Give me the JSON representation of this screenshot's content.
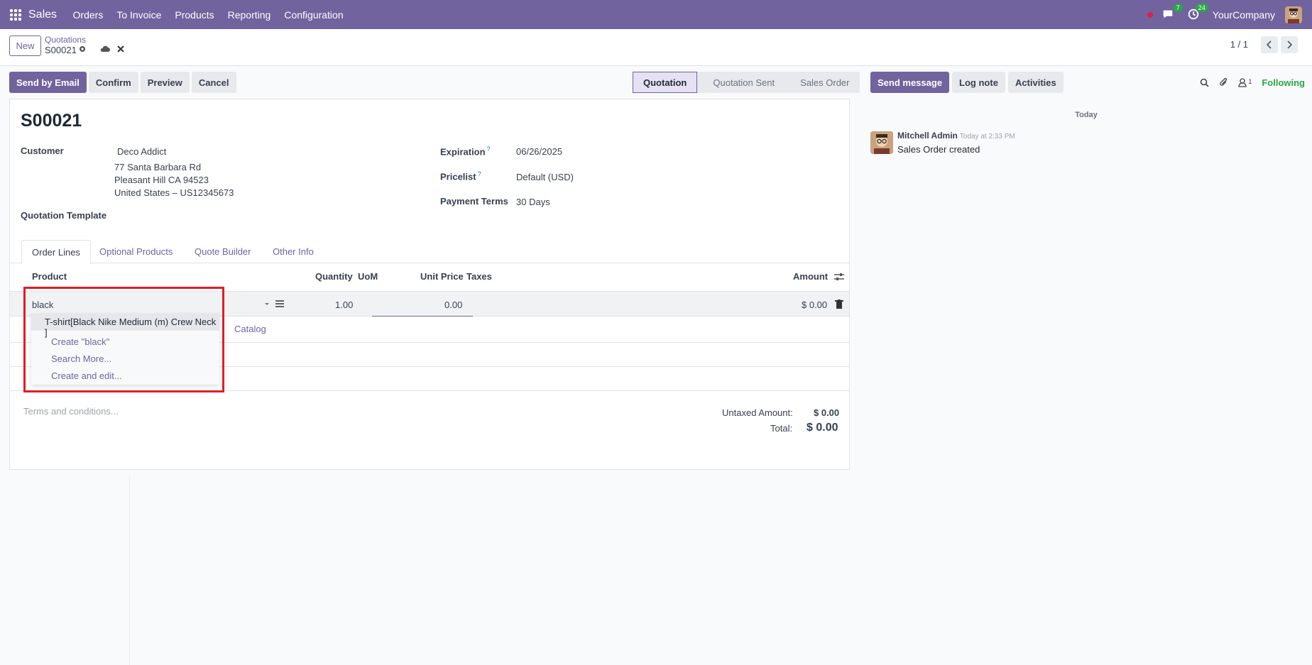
{
  "navbar": {
    "app_name": "Sales",
    "menu": [
      "Orders",
      "To Invoice",
      "Products",
      "Reporting",
      "Configuration"
    ],
    "messages_count": "7",
    "activities_count": "24",
    "company": "YourCompany"
  },
  "control": {
    "new_label": "New",
    "breadcrumb_parent": "Quotations",
    "breadcrumb_current": "S00021",
    "pager": "1 / 1"
  },
  "actions": {
    "send_email": "Send by Email",
    "confirm": "Confirm",
    "preview": "Preview",
    "cancel": "Cancel"
  },
  "status": {
    "stages": [
      "Quotation",
      "Quotation Sent",
      "Sales Order"
    ],
    "active": "Quotation"
  },
  "form": {
    "title": "S00021",
    "customer_label": "Customer",
    "customer_name": "Deco Addict",
    "address_1": "77 Santa Barbara Rd",
    "address_2": "Pleasant Hill CA 94523",
    "address_3": "United States – US12345673",
    "template_label": "Quotation Template",
    "expiration_label": "Expiration",
    "expiration_value": "06/26/2025",
    "pricelist_label": "Pricelist",
    "pricelist_value": "Default (USD)",
    "payment_terms_label": "Payment Terms",
    "payment_terms_value": "30 Days",
    "help_mark": "?"
  },
  "tabs": [
    "Order Lines",
    "Optional Products",
    "Quote Builder",
    "Other Info"
  ],
  "table": {
    "headers": {
      "product": "Product",
      "quantity": "Quantity",
      "uom": "UoM",
      "unit_price": "Unit Price",
      "taxes": "Taxes",
      "amount": "Amount"
    },
    "edit_row": {
      "product_input": "black",
      "quantity": "1.00",
      "unit_price": "0.00",
      "amount": "$ 0.00"
    },
    "catalog_link": "Catalog"
  },
  "autocomplete": {
    "match": "T-shirt[Black Nike Medium (m) Crew Neck ]",
    "create": "Create \"black\"",
    "search_more": "Search More...",
    "create_edit": "Create and edit..."
  },
  "terms_placeholder": "Terms and conditions...",
  "totals": {
    "untaxed_label": "Untaxed Amount:",
    "untaxed_value": "$ 0.00",
    "total_label": "Total:",
    "total_value": "$ 0.00"
  },
  "chatter": {
    "send_message": "Send message",
    "log_note": "Log note",
    "activities": "Activities",
    "followers_count": "1",
    "following": "Following",
    "date_separator": "Today",
    "author": "Mitchell Admin",
    "time": "Today at 2:33 PM",
    "body": "Sales Order created"
  },
  "colors": {
    "brand": "#71639e",
    "success": "#28a745",
    "highlight": "#e11d27"
  }
}
